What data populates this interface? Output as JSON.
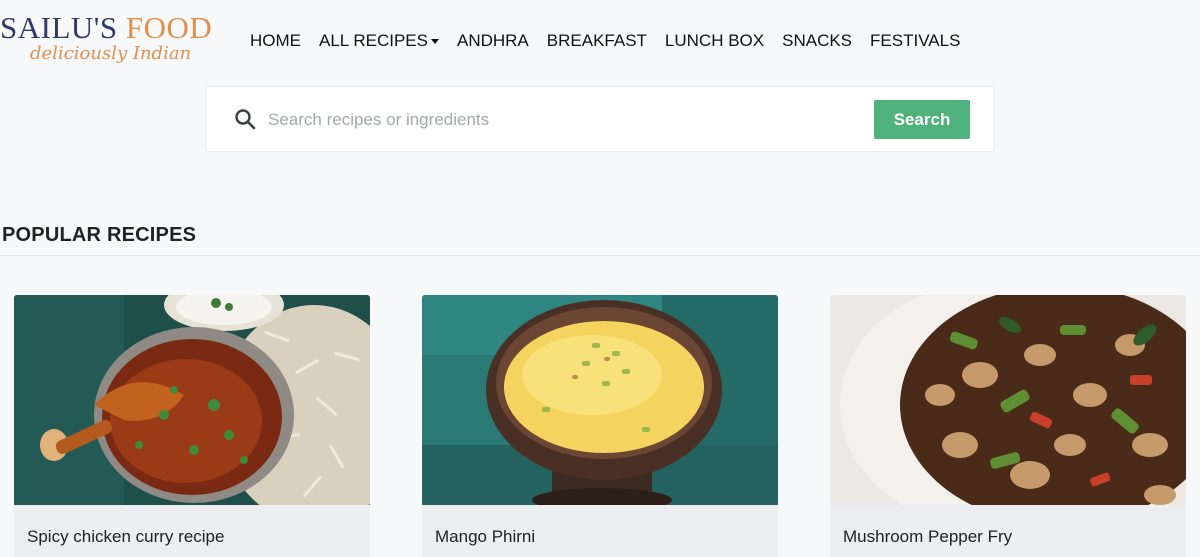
{
  "header": {
    "logo": {
      "name_part1": "SAILU'S",
      "name_part2": "FOOD",
      "tagline": "deliciously Indian"
    },
    "nav": [
      {
        "label": "HOME",
        "has_dropdown": false
      },
      {
        "label": "ALL RECIPES",
        "has_dropdown": true
      },
      {
        "label": "ANDHRA",
        "has_dropdown": false
      },
      {
        "label": "BREAKFAST",
        "has_dropdown": false
      },
      {
        "label": "LUNCH BOX",
        "has_dropdown": false
      },
      {
        "label": "SNACKS",
        "has_dropdown": false
      },
      {
        "label": "FESTIVALS",
        "has_dropdown": false
      }
    ]
  },
  "search": {
    "placeholder": "Search recipes or ingredients",
    "value": "",
    "button_label": "Search",
    "icon": "search-icon"
  },
  "popular": {
    "title": "POPULAR RECIPES",
    "recipes": [
      {
        "title": "Spicy chicken curry recipe",
        "image": "chicken-curry-with-rice-photo"
      },
      {
        "title": "Mango Phirni",
        "image": "mango-phirni-bowl-photo"
      },
      {
        "title": "Mushroom Pepper Fry",
        "image": "mushroom-pepper-fry-photo"
      }
    ]
  },
  "colors": {
    "logo_navy": "#2e3a68",
    "logo_orange": "#e0904c",
    "search_button": "#4fb27a",
    "page_background": "#f7f8fa"
  }
}
